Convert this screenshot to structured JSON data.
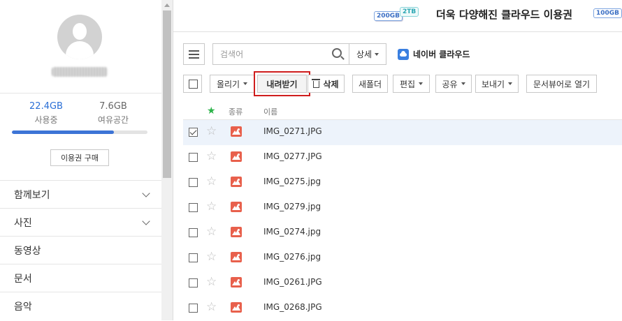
{
  "sidebar": {
    "storage": {
      "used_value": "22.4GB",
      "used_label": "사용중",
      "free_value": "7.6GB",
      "free_label": "여유공간",
      "used_fraction": 0.75
    },
    "buy_button": "이용권 구매",
    "nav": [
      {
        "label": "함께보기",
        "expandable": true
      },
      {
        "label": "사진",
        "expandable": true
      },
      {
        "label": "동영상",
        "expandable": false
      },
      {
        "label": "문서",
        "expandable": false
      },
      {
        "label": "음악",
        "expandable": false
      }
    ]
  },
  "banner": {
    "tag_200": "200GB",
    "tag_2tb": "2TB",
    "text": "더욱 다양해진 클라우드 이용권",
    "tag_100": "100GB"
  },
  "search": {
    "placeholder": "검색어",
    "detail_label": "상세"
  },
  "brand": {
    "label": "네이버 클라우드",
    "accent": "#3a7fe0"
  },
  "toolbar": {
    "upload": "올리기",
    "download": "내려받기",
    "delete": "삭제",
    "new_folder": "새폴더",
    "edit": "편집",
    "share": "공유",
    "send": "보내기",
    "doc_viewer": "문서뷰어로 열기"
  },
  "list": {
    "header_type": "종류",
    "header_name": "이름",
    "files": [
      {
        "name": "IMG_0271.JPG",
        "checked": true
      },
      {
        "name": "IMG_0277.JPG",
        "checked": false
      },
      {
        "name": "IMG_0275.jpg",
        "checked": false
      },
      {
        "name": "IMG_0279.jpg",
        "checked": false
      },
      {
        "name": "IMG_0274.jpg",
        "checked": false
      },
      {
        "name": "IMG_0276.jpg",
        "checked": false
      },
      {
        "name": "IMG_0261.JPG",
        "checked": false
      },
      {
        "name": "IMG_0268.JPG",
        "checked": false
      }
    ]
  }
}
